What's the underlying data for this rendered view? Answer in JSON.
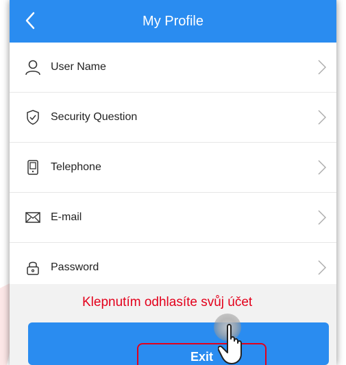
{
  "header": {
    "title": "My Profile",
    "back_icon": "chevron-left-icon",
    "color": "#2a8cf0"
  },
  "list": {
    "items": [
      {
        "label": "User Name",
        "icon": "user-icon"
      },
      {
        "label": "Security Question",
        "icon": "shield-check-icon"
      },
      {
        "label": "Telephone",
        "icon": "phone-icon"
      },
      {
        "label": "E-mail",
        "icon": "envelope-icon"
      },
      {
        "label": "Password",
        "icon": "padlock-icon"
      }
    ],
    "trailing_icon": "chevron-right-icon"
  },
  "annotation": {
    "hint_text": "Klepnutím odhlasíte svůj účet",
    "color": "#e3001b"
  },
  "exit_button": {
    "label": "Exit",
    "color": "#2a8cf0"
  }
}
